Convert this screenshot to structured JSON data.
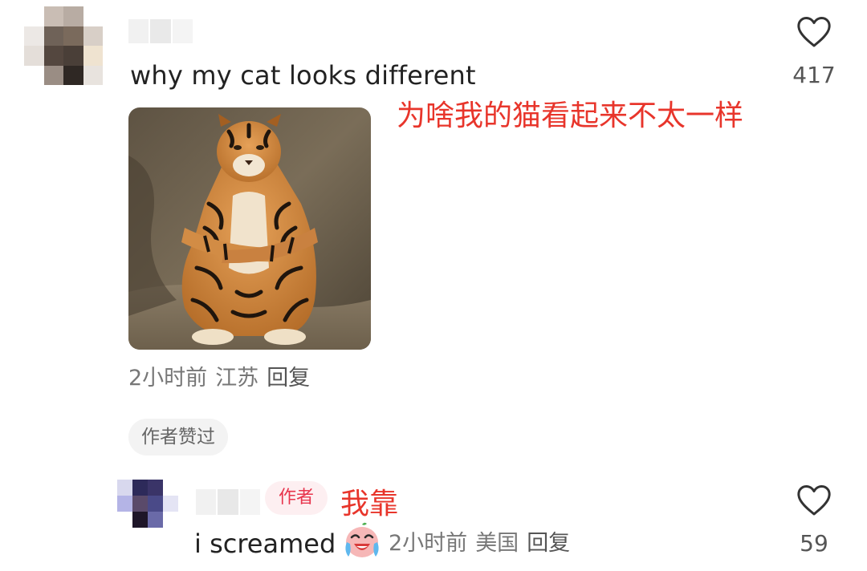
{
  "main_comment": {
    "text": "why my cat looks different",
    "annotation": "为啥我的猫看起来不太一样",
    "like_count": "417",
    "meta": {
      "time": "2小时前",
      "location": "江苏",
      "reply_label": "回复"
    },
    "author_liked_label": "作者赞过"
  },
  "reply": {
    "author_badge": "作者",
    "annotation": "我靠",
    "text": "i screamed",
    "emoji": "crying-laughing-face",
    "meta": {
      "time": "2小时前",
      "location": "美国",
      "reply_label": "回复"
    },
    "like_count": "59"
  },
  "colors": {
    "annotation_red": "#e8352b",
    "author_badge_text": "#e8354d",
    "author_badge_bg": "#fdeff1",
    "meta_gray": "#777777",
    "pill_bg": "#f3f3f3"
  },
  "icons": {
    "like": "heart-outline-icon"
  }
}
